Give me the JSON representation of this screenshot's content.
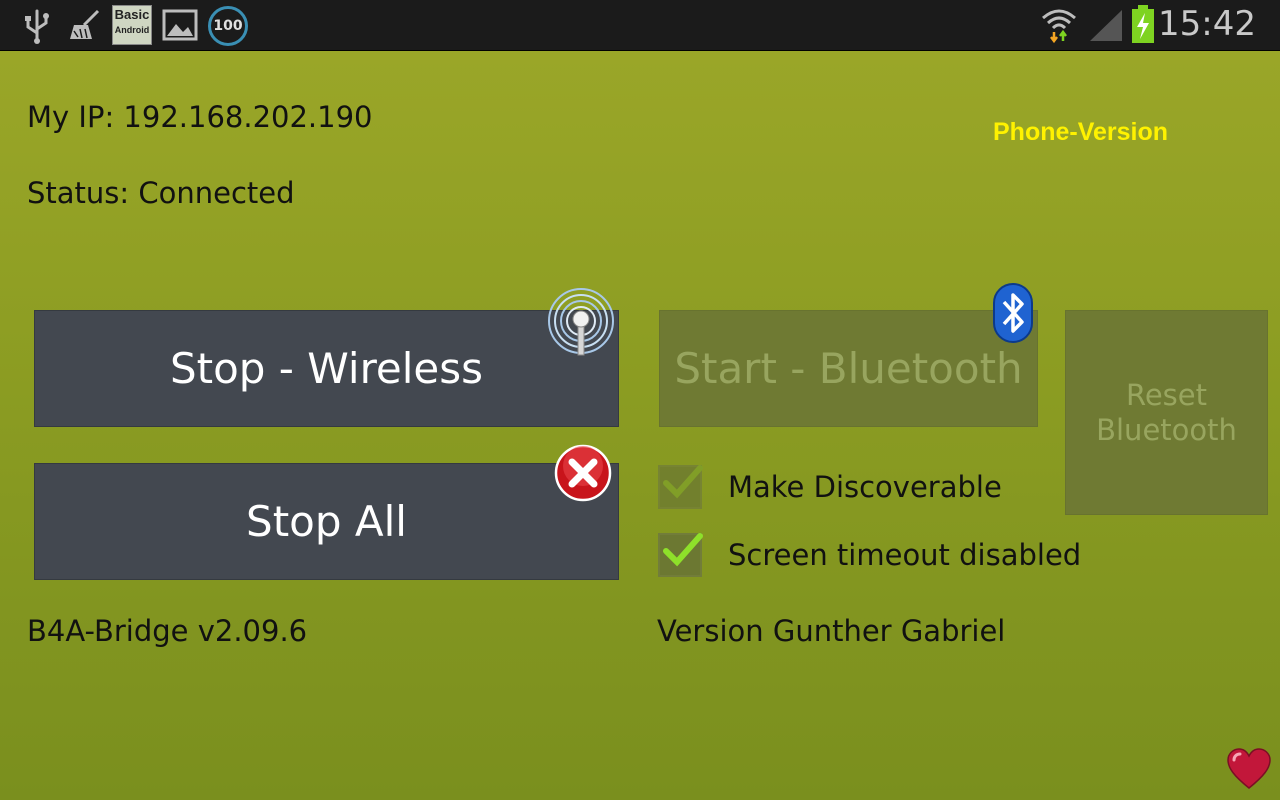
{
  "statusbar": {
    "left_icons": [
      "usb-icon",
      "cleaner-icon",
      "basic4android-icon",
      "gallery-icon",
      "battery-100-icon"
    ],
    "basic_line1": "Basic",
    "basic_line2": "Android",
    "battery_badge": "100",
    "right_icons": [
      "wifi-icon",
      "signal-icon",
      "battery-charging-icon"
    ],
    "time": "15:42"
  },
  "info": {
    "ip": "My IP: 192.168.202.190",
    "status": "Status: Connected",
    "phone_version": "Phone-Version"
  },
  "buttons": {
    "stop_wireless": "Stop - Wireless",
    "stop_all": "Stop All",
    "start_bluetooth": "Start - Bluetooth",
    "reset_bluetooth_line1": "Reset",
    "reset_bluetooth_line2": "Bluetooth"
  },
  "checkboxes": [
    {
      "label": "Make Discoverable",
      "checked": true,
      "enabled": false
    },
    {
      "label": "Screen timeout disabled",
      "checked": true,
      "enabled": true
    }
  ],
  "footer": {
    "version": "B4A-Bridge v2.09.6",
    "author": "Version Gunther Gabriel"
  },
  "colors": {
    "background_top": "#9aa628",
    "background_bottom": "#7a8f1e",
    "button": "#434850",
    "button_disabled": "#6f7a33",
    "phone_version_text": "#fff200",
    "checkmark": "#7ed321"
  },
  "icons": {
    "wireless_badge": "antenna-icon",
    "stop_all_badge": "close-icon",
    "bluetooth_badge": "bluetooth-icon",
    "corner": "heart-icon"
  }
}
